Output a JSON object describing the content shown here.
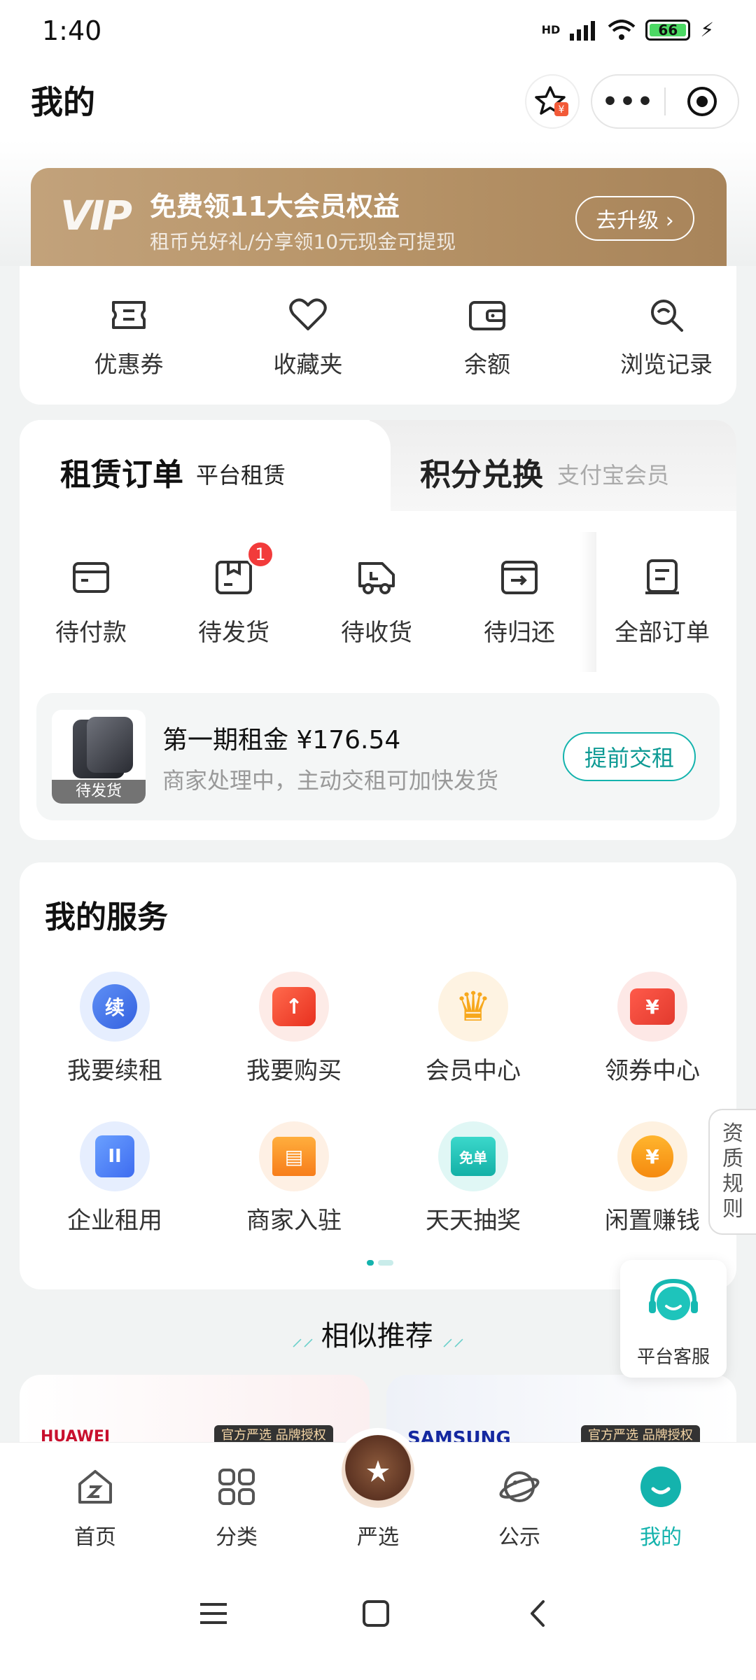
{
  "status": {
    "time": "1:40",
    "net": "HD",
    "battery": "66"
  },
  "header": {
    "title": "我的",
    "more": "•••"
  },
  "vip": {
    "logo": "VIP",
    "title": "免费领11大会员权益",
    "subtitle": "租币兑好礼/分享领10元现金可提现",
    "button": "去升级 ›"
  },
  "tools": [
    {
      "label": "优惠券",
      "icon": "ticket-icon"
    },
    {
      "label": "收藏夹",
      "icon": "heart-icon"
    },
    {
      "label": "余额",
      "icon": "wallet-icon"
    },
    {
      "label": "浏览记录",
      "icon": "history-icon"
    }
  ],
  "orders": {
    "tab1": "租赁订单",
    "tab1_sub": "平台租赁",
    "tab2": "积分兑换",
    "tab2_sub": "支付宝会员",
    "types": [
      {
        "label": "待付款",
        "icon": "card-icon"
      },
      {
        "label": "待发货",
        "icon": "box-icon",
        "badge": "1"
      },
      {
        "label": "待收货",
        "icon": "truck-icon"
      },
      {
        "label": "待归还",
        "icon": "return-icon"
      },
      {
        "label": "全部订单",
        "icon": "list-icon"
      }
    ],
    "pending": {
      "tag": "待发货",
      "title": "第一期租金 ¥176.54",
      "subtitle": "商家处理中，主动交租可加快发货",
      "button": "提前交租"
    }
  },
  "services": {
    "title": "我的服务",
    "items": [
      {
        "label": "我要续租",
        "icon": "renew-icon",
        "glyph": "续"
      },
      {
        "label": "我要购买",
        "icon": "buy-icon",
        "glyph": "↑"
      },
      {
        "label": "会员中心",
        "icon": "crown-icon",
        "glyph": "♛"
      },
      {
        "label": "领券中心",
        "icon": "coupon-icon",
        "glyph": "¥"
      },
      {
        "label": "企业租用",
        "icon": "enterprise-icon",
        "glyph": "II"
      },
      {
        "label": "商家入驻",
        "icon": "shop-icon",
        "glyph": "▤"
      },
      {
        "label": "天天抽奖",
        "icon": "lottery-icon",
        "glyph": "免单"
      },
      {
        "label": "闲置赚钱",
        "icon": "moneybag-icon",
        "glyph": "¥"
      }
    ]
  },
  "side_rules": [
    "资",
    "质",
    "规",
    "则"
  ],
  "customer_service": "平台客服",
  "recommend": {
    "title": "相似推荐",
    "left_brand": "HUAWEI",
    "right_brand": "SAMSUNG",
    "official_tag": "官方严选 品牌授权"
  },
  "nav": [
    {
      "label": "首页",
      "icon": "home-icon"
    },
    {
      "label": "分类",
      "icon": "grid-icon"
    },
    {
      "label": "严选",
      "icon": "select-icon"
    },
    {
      "label": "公示",
      "icon": "planet-icon"
    },
    {
      "label": "我的",
      "icon": "profile-icon",
      "active": true
    }
  ],
  "colors": {
    "accent": "#14b3ad",
    "vip_gold": "#b89569",
    "badge": "#f23b3b"
  }
}
